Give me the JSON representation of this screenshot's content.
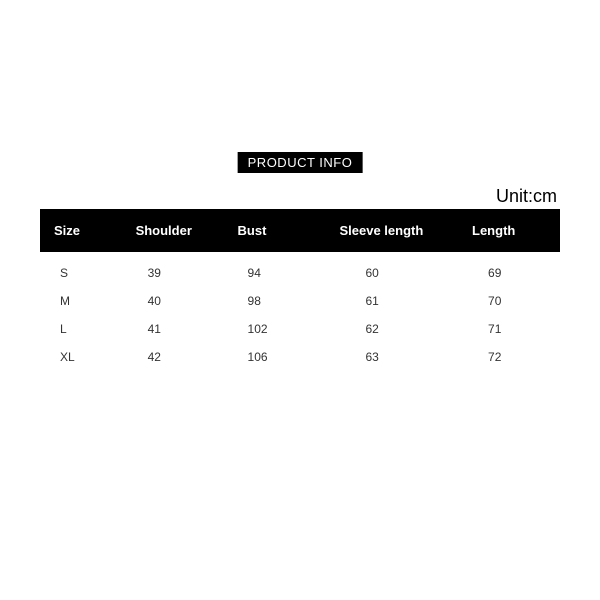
{
  "badge_label": "PRODUCT INFO",
  "unit_label": "Unit:cm",
  "columns": [
    "Size",
    "Shoulder",
    "Bust",
    "Sleeve length",
    "Length"
  ],
  "rows": [
    [
      "S",
      "39",
      "94",
      "60",
      "69"
    ],
    [
      "M",
      "40",
      "98",
      "61",
      "70"
    ],
    [
      "L",
      "41",
      "102",
      "62",
      "71"
    ],
    [
      "XL",
      "42",
      "106",
      "63",
      "72"
    ]
  ],
  "chart_data": {
    "type": "table",
    "title": "PRODUCT INFO",
    "unit": "cm",
    "columns": [
      "Size",
      "Shoulder",
      "Bust",
      "Sleeve length",
      "Length"
    ],
    "data": [
      {
        "Size": "S",
        "Shoulder": 39,
        "Bust": 94,
        "Sleeve length": 60,
        "Length": 69
      },
      {
        "Size": "M",
        "Shoulder": 40,
        "Bust": 98,
        "Sleeve length": 61,
        "Length": 70
      },
      {
        "Size": "L",
        "Shoulder": 41,
        "Bust": 102,
        "Sleeve length": 62,
        "Length": 71
      },
      {
        "Size": "XL",
        "Shoulder": 42,
        "Bust": 106,
        "Sleeve length": 63,
        "Length": 72
      }
    ]
  }
}
